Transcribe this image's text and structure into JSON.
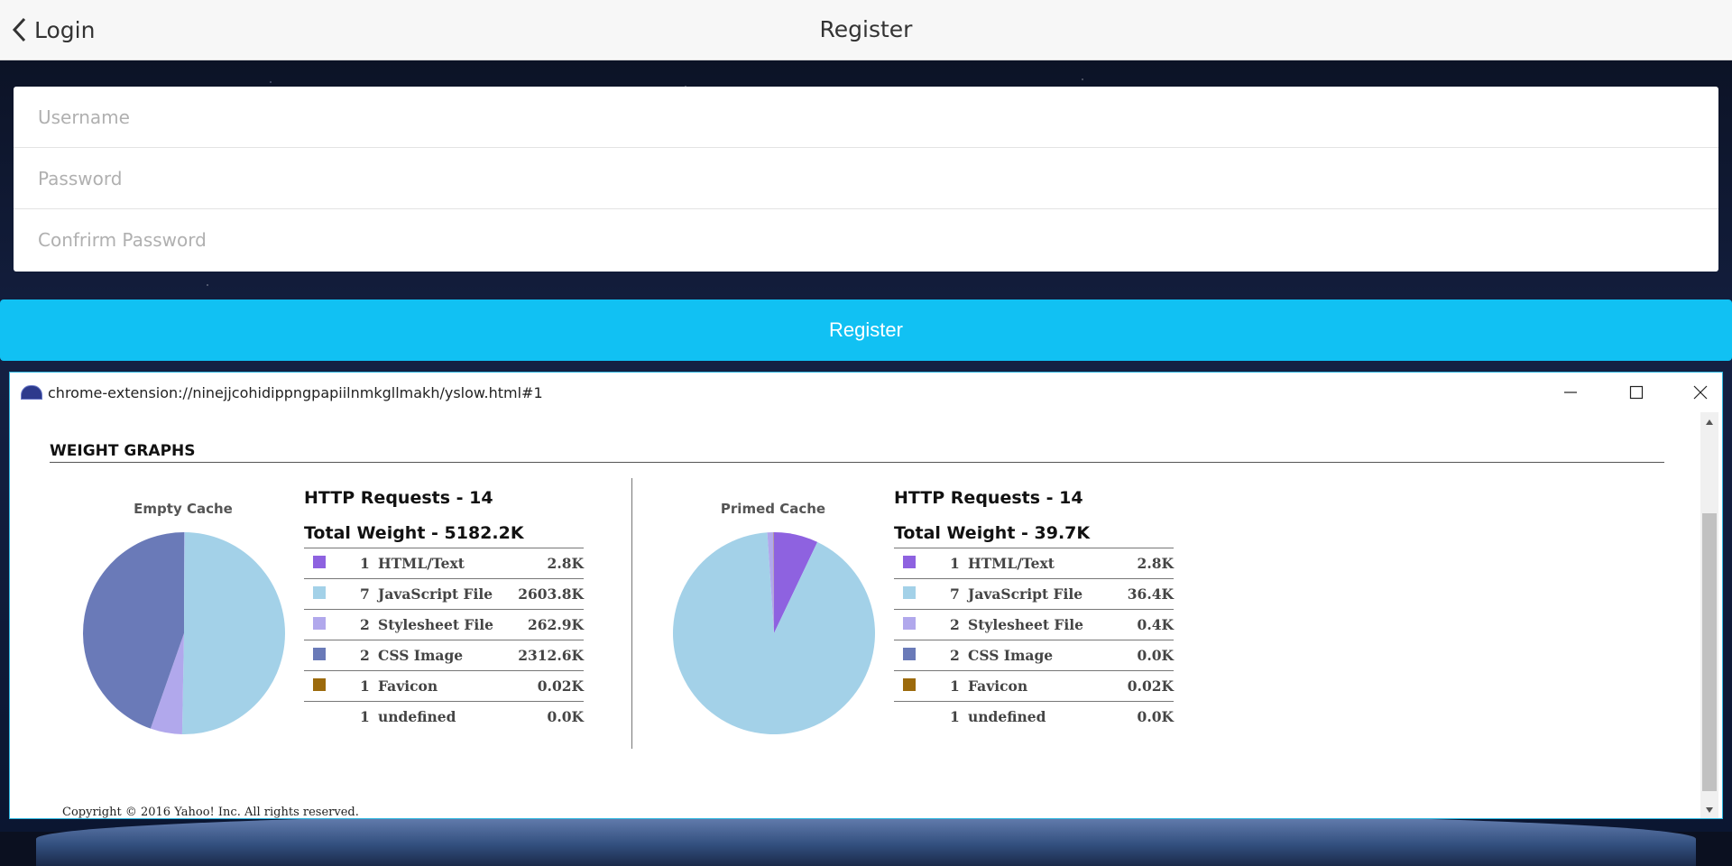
{
  "nav": {
    "back_label": "Login",
    "title": "Register"
  },
  "form": {
    "username_placeholder": "Username",
    "password_placeholder": "Password",
    "confirm_placeholder": "Confrirm Password",
    "submit_label": "Register"
  },
  "popup": {
    "url": "chrome-extension://ninejjcohidippngpapiilnmkgllmakh/yslow.html#1",
    "section_title": "WEIGHT GRAPHS",
    "copyright": "Copyright © 2016 Yahoo! Inc. All rights reserved.",
    "empty": {
      "pie_label": "Empty Cache",
      "requests": "HTTP Requests - 14",
      "weight": "Total Weight - 5182.2K",
      "rows": [
        {
          "count": "1",
          "type": "HTML/Text",
          "size": "2.8K",
          "color": "#8e62e0"
        },
        {
          "count": "7",
          "type": "JavaScript File",
          "size": "2603.8K",
          "color": "#a3d1e8"
        },
        {
          "count": "2",
          "type": "Stylesheet File",
          "size": "262.9K",
          "color": "#b1a8ec"
        },
        {
          "count": "2",
          "type": "CSS Image",
          "size": "2312.6K",
          "color": "#6a7ab8"
        },
        {
          "count": "1",
          "type": "Favicon",
          "size": "0.02K",
          "color": "#9c6a0c"
        },
        {
          "count": "1",
          "type": "undefined",
          "size": "0.0K",
          "color": ""
        }
      ]
    },
    "primed": {
      "pie_label": "Primed Cache",
      "requests": "HTTP Requests - 14",
      "weight": "Total Weight - 39.7K",
      "rows": [
        {
          "count": "1",
          "type": "HTML/Text",
          "size": "2.8K",
          "color": "#8e62e0"
        },
        {
          "count": "7",
          "type": "JavaScript File",
          "size": "36.4K",
          "color": "#a3d1e8"
        },
        {
          "count": "2",
          "type": "Stylesheet File",
          "size": "0.4K",
          "color": "#b1a8ec"
        },
        {
          "count": "2",
          "type": "CSS Image",
          "size": "0.0K",
          "color": "#6a7ab8"
        },
        {
          "count": "1",
          "type": "Favicon",
          "size": "0.02K",
          "color": "#9c6a0c"
        },
        {
          "count": "1",
          "type": "undefined",
          "size": "0.0K",
          "color": ""
        }
      ]
    }
  }
}
